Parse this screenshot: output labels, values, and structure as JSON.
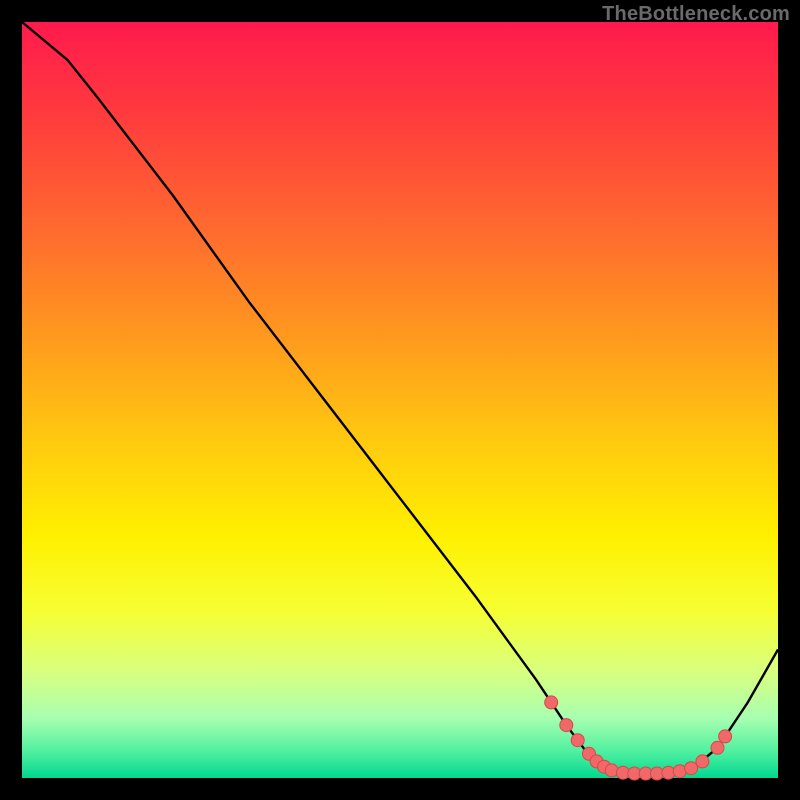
{
  "watermark": "TheBottleneck.com",
  "colors": {
    "curve": "#000000",
    "marker": "#f06868",
    "marker_stroke": "#d84848"
  },
  "chart_data": {
    "type": "line",
    "title": "",
    "xlabel": "",
    "ylabel": "",
    "xlim": [
      0,
      100
    ],
    "ylim": [
      0,
      100
    ],
    "grid": false,
    "curve": [
      {
        "x": 0,
        "y": 100
      },
      {
        "x": 6,
        "y": 95
      },
      {
        "x": 10,
        "y": 90
      },
      {
        "x": 20,
        "y": 77
      },
      {
        "x": 30,
        "y": 63
      },
      {
        "x": 40,
        "y": 50
      },
      {
        "x": 50,
        "y": 37
      },
      {
        "x": 60,
        "y": 24
      },
      {
        "x": 68,
        "y": 13
      },
      {
        "x": 72,
        "y": 7
      },
      {
        "x": 75,
        "y": 3
      },
      {
        "x": 78,
        "y": 1
      },
      {
        "x": 82,
        "y": 0.6
      },
      {
        "x": 86,
        "y": 0.6
      },
      {
        "x": 89,
        "y": 1.5
      },
      {
        "x": 92,
        "y": 4
      },
      {
        "x": 96,
        "y": 10
      },
      {
        "x": 100,
        "y": 17
      }
    ],
    "markers": [
      {
        "x": 70,
        "y": 10
      },
      {
        "x": 72,
        "y": 7
      },
      {
        "x": 73.5,
        "y": 5
      },
      {
        "x": 75,
        "y": 3.2
      },
      {
        "x": 76,
        "y": 2.2
      },
      {
        "x": 77,
        "y": 1.5
      },
      {
        "x": 78,
        "y": 1
      },
      {
        "x": 79.5,
        "y": 0.7
      },
      {
        "x": 81,
        "y": 0.6
      },
      {
        "x": 82.5,
        "y": 0.6
      },
      {
        "x": 84,
        "y": 0.6
      },
      {
        "x": 85.5,
        "y": 0.7
      },
      {
        "x": 87,
        "y": 0.9
      },
      {
        "x": 88.5,
        "y": 1.3
      },
      {
        "x": 90,
        "y": 2.2
      },
      {
        "x": 92,
        "y": 4
      },
      {
        "x": 93,
        "y": 5.5
      }
    ]
  }
}
